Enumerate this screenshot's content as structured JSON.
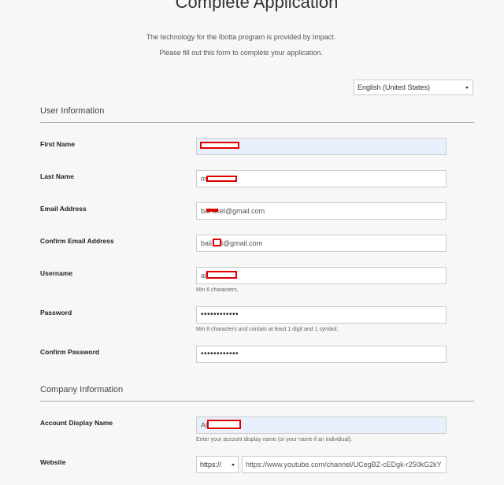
{
  "header": {
    "title": "Complete Application",
    "intro_line1": "The technology for the Ibotta program is provided by Impact.",
    "intro_line2": "Please fill out this form to complete your application."
  },
  "language_select": {
    "value": "English (United States)"
  },
  "sections": {
    "user_info": "User Information",
    "company_info": "Company Information"
  },
  "fields": {
    "first_name": {
      "label": "First Name",
      "value": ""
    },
    "last_name": {
      "label": "Last Name",
      "value": "m"
    },
    "email": {
      "label": "Email Address",
      "value": "bai        akel@gmail.com"
    },
    "confirm_email": {
      "label": "Confirm Email Address",
      "value": "baii     kel@gmail.com"
    },
    "username": {
      "label": "Username",
      "value": "al",
      "help": "Min 6 characters."
    },
    "password": {
      "label": "Password",
      "value": "••••••••••••",
      "help": "Min 8 characters and contain at least 1 digit and 1 symbol."
    },
    "confirm_password": {
      "label": "Confirm Password",
      "value": "••••••••••••"
    },
    "account_display_name": {
      "label": "Account Display Name",
      "value": "Ab",
      "help": "Enter your account display name (or your name if an individual)."
    },
    "website": {
      "label": "Website",
      "protocol": "https://",
      "url": "https://www.youtube.com/channel/UCegBZ-cEDgk-r250kG2kY"
    }
  },
  "colors": {
    "redaction": "#e00000",
    "autofill_bg": "#e8f0fe",
    "page_bg": "#f7f7f7"
  },
  "icons": {
    "dropdown": "chevron-down-icon"
  }
}
